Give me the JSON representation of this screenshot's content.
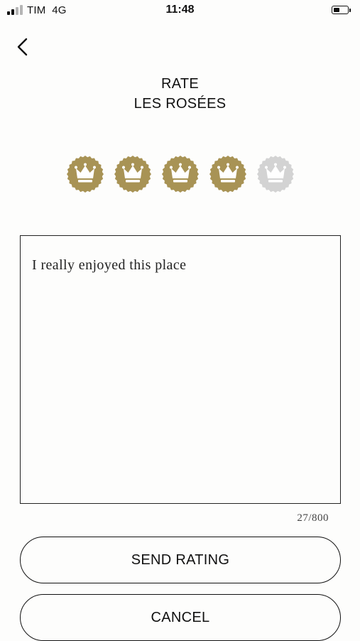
{
  "status_bar": {
    "carrier": "TIM",
    "network": "4G",
    "time": "11:48",
    "signal_bars_active": 2,
    "signal_bars_total": 4,
    "battery_level": 0.45
  },
  "nav": {
    "back_icon": "chevron-left-icon"
  },
  "header": {
    "line1": "RATE",
    "line2": "LES ROSÉES"
  },
  "rating": {
    "value": 4,
    "max": 5,
    "icon": "crown-seal-icon",
    "active_color": "#a89355",
    "inactive_color": "#d3d3d3"
  },
  "review": {
    "text": "I really enjoyed this place",
    "counter": "27/800"
  },
  "buttons": {
    "send": "SEND RATING",
    "cancel": "CANCEL"
  }
}
